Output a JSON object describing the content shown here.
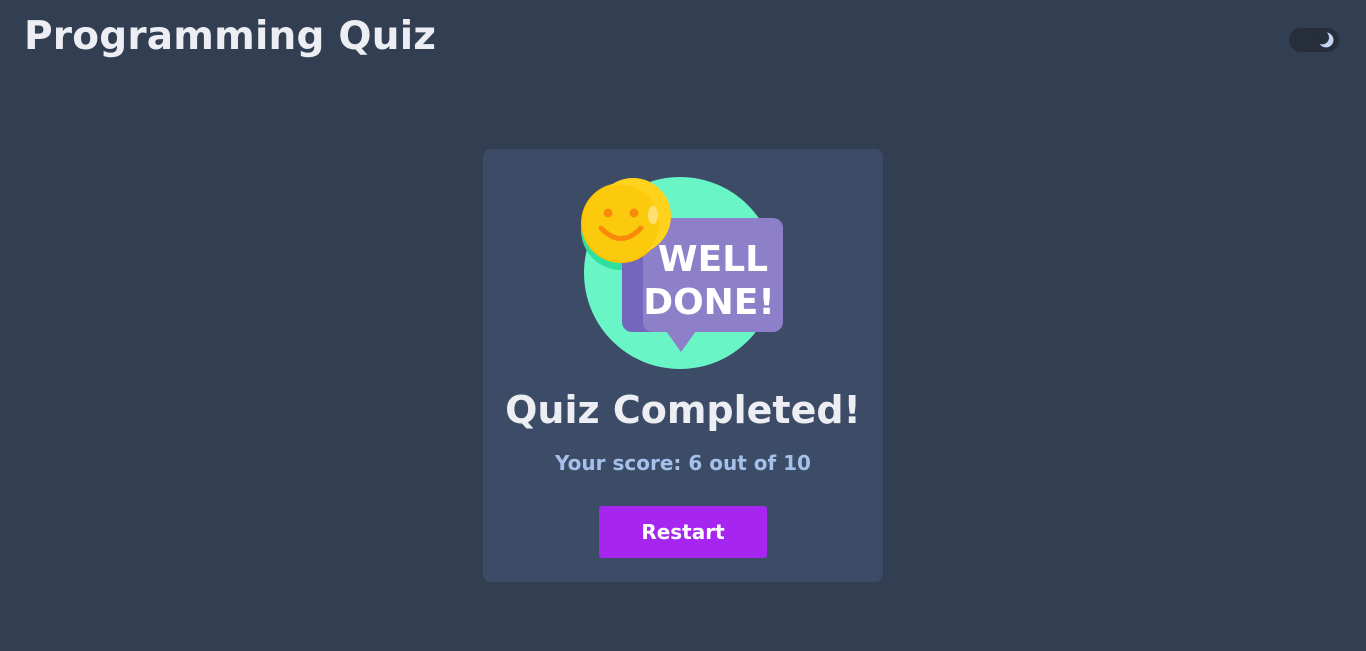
{
  "header": {
    "title": "Programming Quiz",
    "theme_toggle": {
      "icon": "moon-icon",
      "state": "dark"
    }
  },
  "result": {
    "badge_text_line1": "WELL",
    "badge_text_line2": "DONE!",
    "title": "Quiz Completed!",
    "score_text": "Your score: 6 out of 10",
    "restart_label": "Restart"
  },
  "colors": {
    "background": "#323e52",
    "card": "#3c4c66",
    "accent_button": "#a626f0",
    "score_text": "#a5c0ea",
    "illustration_circle": "#6af5c6",
    "speech_bubble": "#8e7fc9",
    "smiley": "#fcc400"
  }
}
